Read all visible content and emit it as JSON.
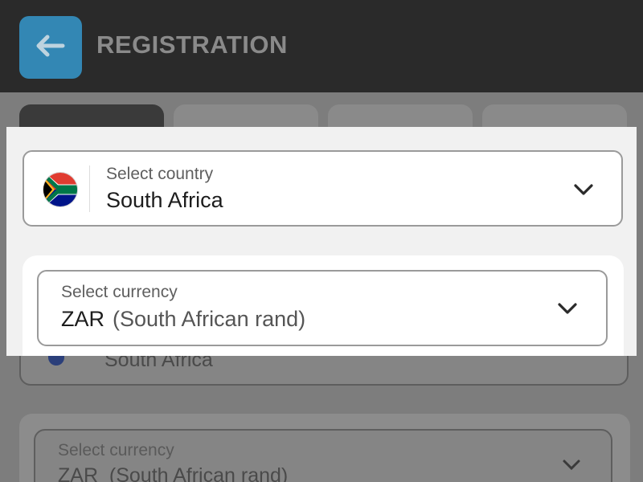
{
  "header": {
    "title": "REGISTRATION",
    "back_icon": "arrow-left-icon",
    "accent_color": "#3592c4"
  },
  "country": {
    "label": "Select country",
    "value": "South Africa",
    "flag_icon": "south-africa-flag-icon",
    "chevron_icon": "chevron-down-icon"
  },
  "currency": {
    "label": "Select currency",
    "code": "ZAR",
    "name": "(South African rand)",
    "chevron_icon": "chevron-down-icon"
  },
  "background": {
    "country_value": "South Africa",
    "currency_label": "Select currency",
    "currency_value": "ZAR  (South African rand)"
  }
}
